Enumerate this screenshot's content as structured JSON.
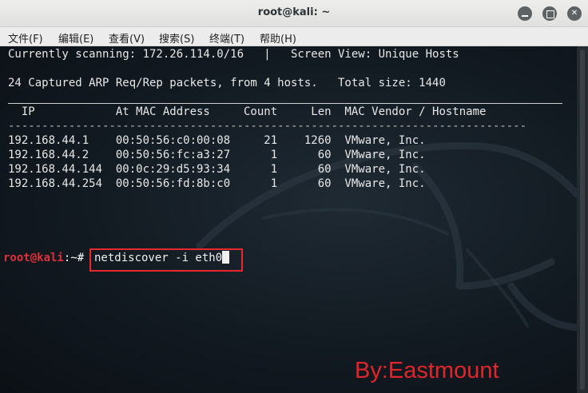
{
  "window": {
    "title": "root@kali: ~",
    "controls": [
      "minimize-icon",
      "maximize-icon",
      "close-icon"
    ]
  },
  "menubar": {
    "items": [
      "文件(F)",
      "编辑(E)",
      "查看(V)",
      "搜索(S)",
      "终端(T)",
      "帮助(H)"
    ]
  },
  "terminal": {
    "scan_line": "Currently scanning: 172.26.114.0/16   |   Screen View: Unique Hosts",
    "summary_line": "24 Captured ARP Req/Rep packets, from 4 hosts.   Total size: 1440",
    "header_line": "  IP            At MAC Address     Count     Len  MAC Vendor / Hostname",
    "dash_line": "-----------------------------------------------------------------------------",
    "rows": [
      {
        "text": "192.168.44.1    00:50:56:c0:00:08     21    1260  VMware, Inc."
      },
      {
        "text": "192.168.44.2    00:50:56:fc:a3:27      1      60  VMware, Inc."
      },
      {
        "text": "192.168.44.144  00:0c:29:d5:93:34      1      60  VMware, Inc."
      },
      {
        "text": "192.168.44.254  00:50:56:fd:8b:c0      1      60  VMware, Inc."
      }
    ],
    "prompt": {
      "user_host": "root@kali",
      "separator": ":",
      "path": "~#",
      "command": "netdiscover -i eth0"
    }
  },
  "watermark": "By:Eastmount",
  "colors": {
    "prompt_user": "#e0303a",
    "highlight_box": "#e8282d",
    "watermark": "#e0252b",
    "terminal_bg": "#121a21"
  }
}
